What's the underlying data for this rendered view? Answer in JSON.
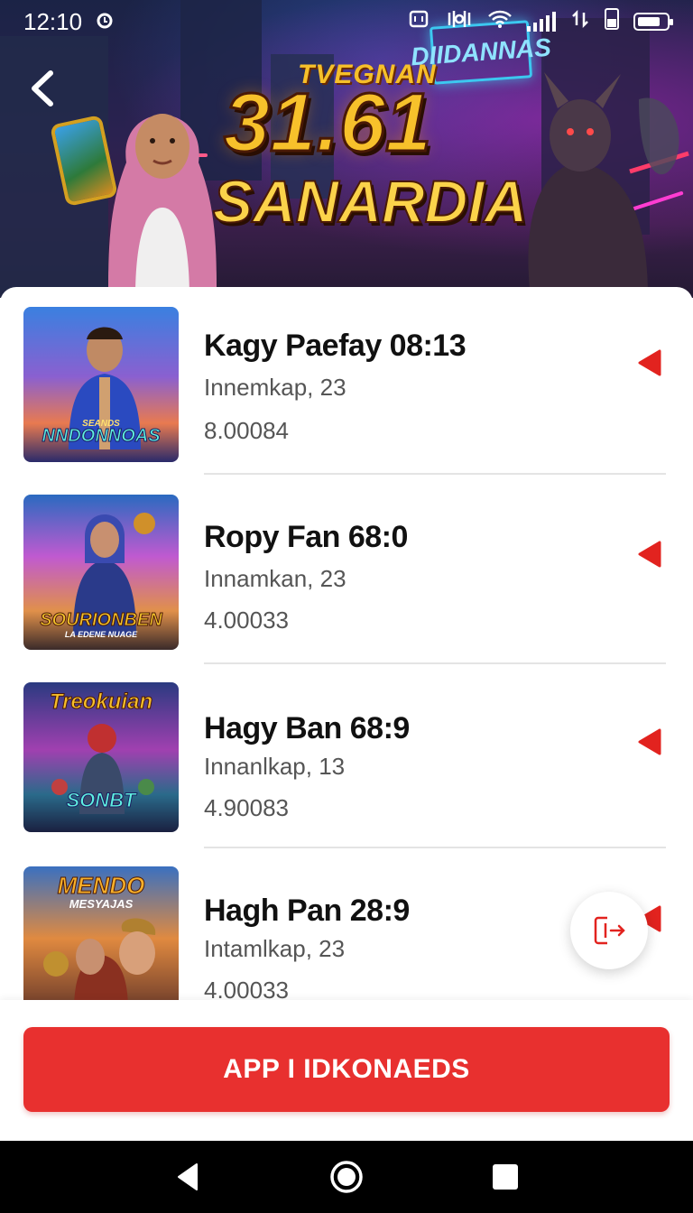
{
  "status_bar": {
    "time": "12:10",
    "icons": [
      "alarm-icon",
      "nfc-icon",
      "vibrate-icon",
      "wifi-icon",
      "signal-icon",
      "data-icon",
      "battery-icon"
    ]
  },
  "hero": {
    "title_small": "TVEGNAN",
    "title_big": "31.61",
    "title_sub": "SANARDIA",
    "sign_text": "DIIDANNAS"
  },
  "items": [
    {
      "title": "Kagy Paefay 08:13",
      "subtitle": "Innemkap, 23",
      "value": "8.00084",
      "thumb_label": "NNDONNOAS",
      "thumb_label_top": "SEANDS"
    },
    {
      "title": "Ropy Fan 68:0",
      "subtitle": "Innamkan, 23",
      "value": "4.00033",
      "thumb_label": "SOURIONBEN",
      "thumb_label_top": "LA EDENE NUAGE"
    },
    {
      "title": "Hagy Ban 68:9",
      "subtitle": "Innanlkap, 13",
      "value": "4.90083",
      "thumb_label": "Treokuian",
      "thumb_label_top": "SONBT"
    },
    {
      "title": "Hagh Pan 28:9",
      "subtitle": "Intamlkap, 23",
      "value": "4.00033",
      "thumb_label": "MENDO",
      "thumb_label_top": "MESYAJAS"
    }
  ],
  "cta": {
    "label": "APP I IDKONAEDS"
  },
  "colors": {
    "accent": "#e8302f",
    "title": "#111111",
    "muted": "#555555",
    "divider": "#e4e4e4"
  },
  "nav": {
    "back_icon": "back-triangle-icon",
    "home_icon": "home-circle-icon",
    "recents_icon": "recents-square-icon"
  }
}
